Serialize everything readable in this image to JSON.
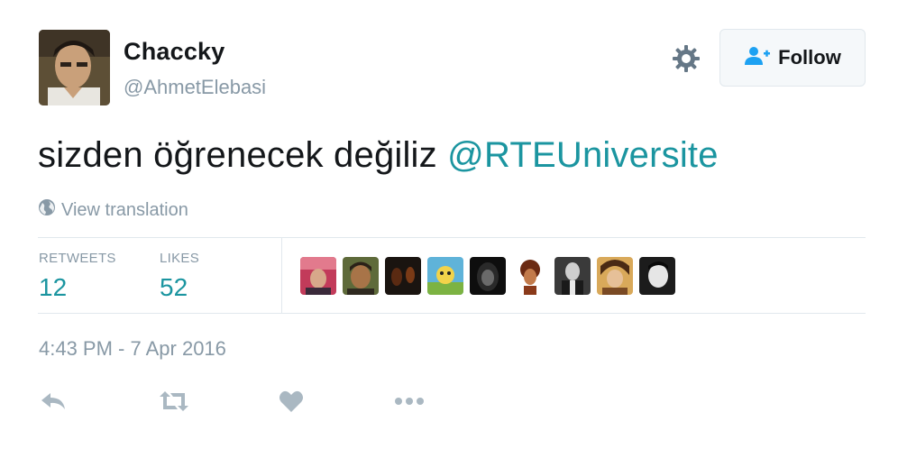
{
  "author": {
    "display_name": "Chaccky",
    "screen_name": "@AhmetElebasi"
  },
  "header": {
    "settings_icon": "gear-icon",
    "follow_label": "Follow",
    "follow_icon": "add-person-icon"
  },
  "tweet": {
    "text": "sizden öğrenecek değiliz ",
    "mention": "@RTEUniversite",
    "view_translation": "View translation",
    "timestamp": "4:43 PM - 7 Apr 2016"
  },
  "stats": {
    "retweets_label": "RETWEETS",
    "retweets_count": "12",
    "likes_label": "LIKES",
    "likes_count": "52"
  },
  "actions": [
    "reply-icon",
    "retweet-icon",
    "like-icon",
    "more-icon"
  ],
  "colors": {
    "accent": "#1b95a0",
    "muted": "#8899a6",
    "border": "#e1e8ed",
    "follow_icon": "#1da1f2"
  }
}
